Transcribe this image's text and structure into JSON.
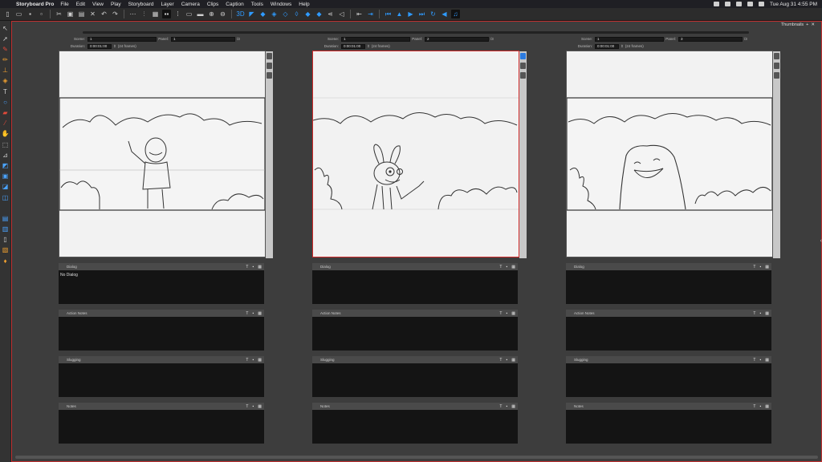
{
  "menubar": {
    "app_name": "Storyboard Pro",
    "items": [
      "File",
      "Edit",
      "View",
      "Play",
      "Storyboard",
      "Layer",
      "Camera",
      "Clips",
      "Caption",
      "Tools",
      "Windows",
      "Help"
    ],
    "clock": "Tue Aug 31  4:55 PM"
  },
  "workspace": {
    "thumbnails_label": "Thumbnails"
  },
  "panels": [
    {
      "scene_label": "Scene:",
      "scene_value": "1",
      "panel_label": "Panel:",
      "panel_value": "1",
      "panel_total": "/3",
      "duration_label": "Duration:",
      "duration_value": "0:00:01:00",
      "duration_frames": "(24 frames)",
      "selected": false,
      "sections": [
        {
          "label": "Dialog",
          "text": "No Dialog"
        },
        {
          "label": "Action Notes",
          "text": ""
        },
        {
          "label": "Slugging",
          "text": ""
        },
        {
          "label": "Notes",
          "text": ""
        }
      ]
    },
    {
      "scene_label": "Scene:",
      "scene_value": "1",
      "panel_label": "Panel:",
      "panel_value": "2",
      "panel_total": "/3",
      "duration_label": "Duration:",
      "duration_value": "0:00:01:00",
      "duration_frames": "(24 frames)",
      "selected": true,
      "sections": [
        {
          "label": "Dialog",
          "text": ""
        },
        {
          "label": "Action Notes",
          "text": ""
        },
        {
          "label": "Slugging",
          "text": ""
        },
        {
          "label": "Notes",
          "text": ""
        }
      ]
    },
    {
      "scene_label": "Scene:",
      "scene_value": "1",
      "panel_label": "Panel:",
      "panel_value": "3",
      "panel_total": "/3",
      "duration_label": "Duration:",
      "duration_value": "0:00:01:00",
      "duration_frames": "(24 frames)",
      "selected": false,
      "sections": [
        {
          "label": "Dialog",
          "text": ""
        },
        {
          "label": "Action Notes",
          "text": ""
        },
        {
          "label": "Slugging",
          "text": ""
        },
        {
          "label": "Notes",
          "text": ""
        }
      ]
    }
  ],
  "colors": {
    "selection": "#d12b2b",
    "accent": "#2f9bff"
  }
}
